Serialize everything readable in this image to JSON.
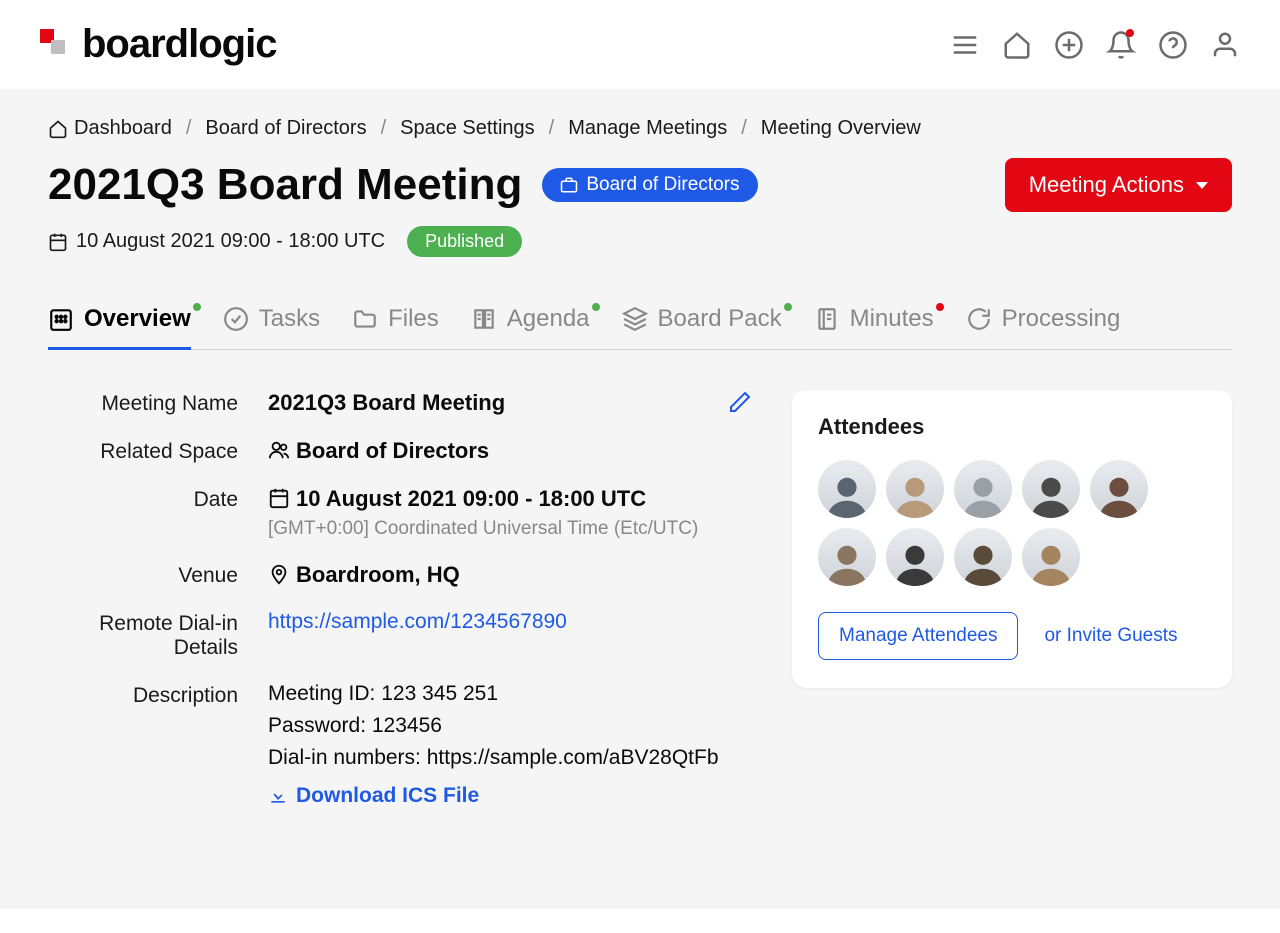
{
  "brand": "boardlogic",
  "breadcrumbs": [
    "Dashboard",
    "Board of Directors",
    "Space Settings",
    "Manage Meetings",
    "Meeting Overview"
  ],
  "pageTitle": "2021Q3 Board Meeting",
  "spaceChip": "Board of Directors",
  "meetingActionsLabel": "Meeting Actions",
  "dateTimeSummary": "10 August 2021 09:00 - 18:00 UTC",
  "publishedLabel": "Published",
  "tabs": [
    "Overview",
    "Tasks",
    "Files",
    "Agenda",
    "Board Pack",
    "Minutes",
    "Processing"
  ],
  "fields": {
    "meetingNameLabel": "Meeting Name",
    "meetingNameValue": "2021Q3 Board Meeting",
    "relatedSpaceLabel": "Related Space",
    "relatedSpaceValue": "Board of Directors",
    "dateLabel": "Date",
    "dateValue": "10 August 2021 09:00 - 18:00 UTC",
    "dateSub": "[GMT+0:00] Coordinated Universal Time (Etc/UTC)",
    "venueLabel": "Venue",
    "venueValue": "Boardroom, HQ",
    "dialInLabel": "Remote Dial-in Details",
    "dialInLink": "https://sample.com/1234567890",
    "descriptionLabel": "Description",
    "descLine1": "Meeting ID: 123 345 251",
    "descLine2": "Password: 123456",
    "descLine3": "Dial-in numbers: https://sample.com/aBV28QtFb",
    "downloadIcs": "Download ICS File"
  },
  "attendees": {
    "title": "Attendees",
    "manageLabel": "Manage Attendees",
    "inviteLabel": "or Invite Guests",
    "count": 9
  }
}
